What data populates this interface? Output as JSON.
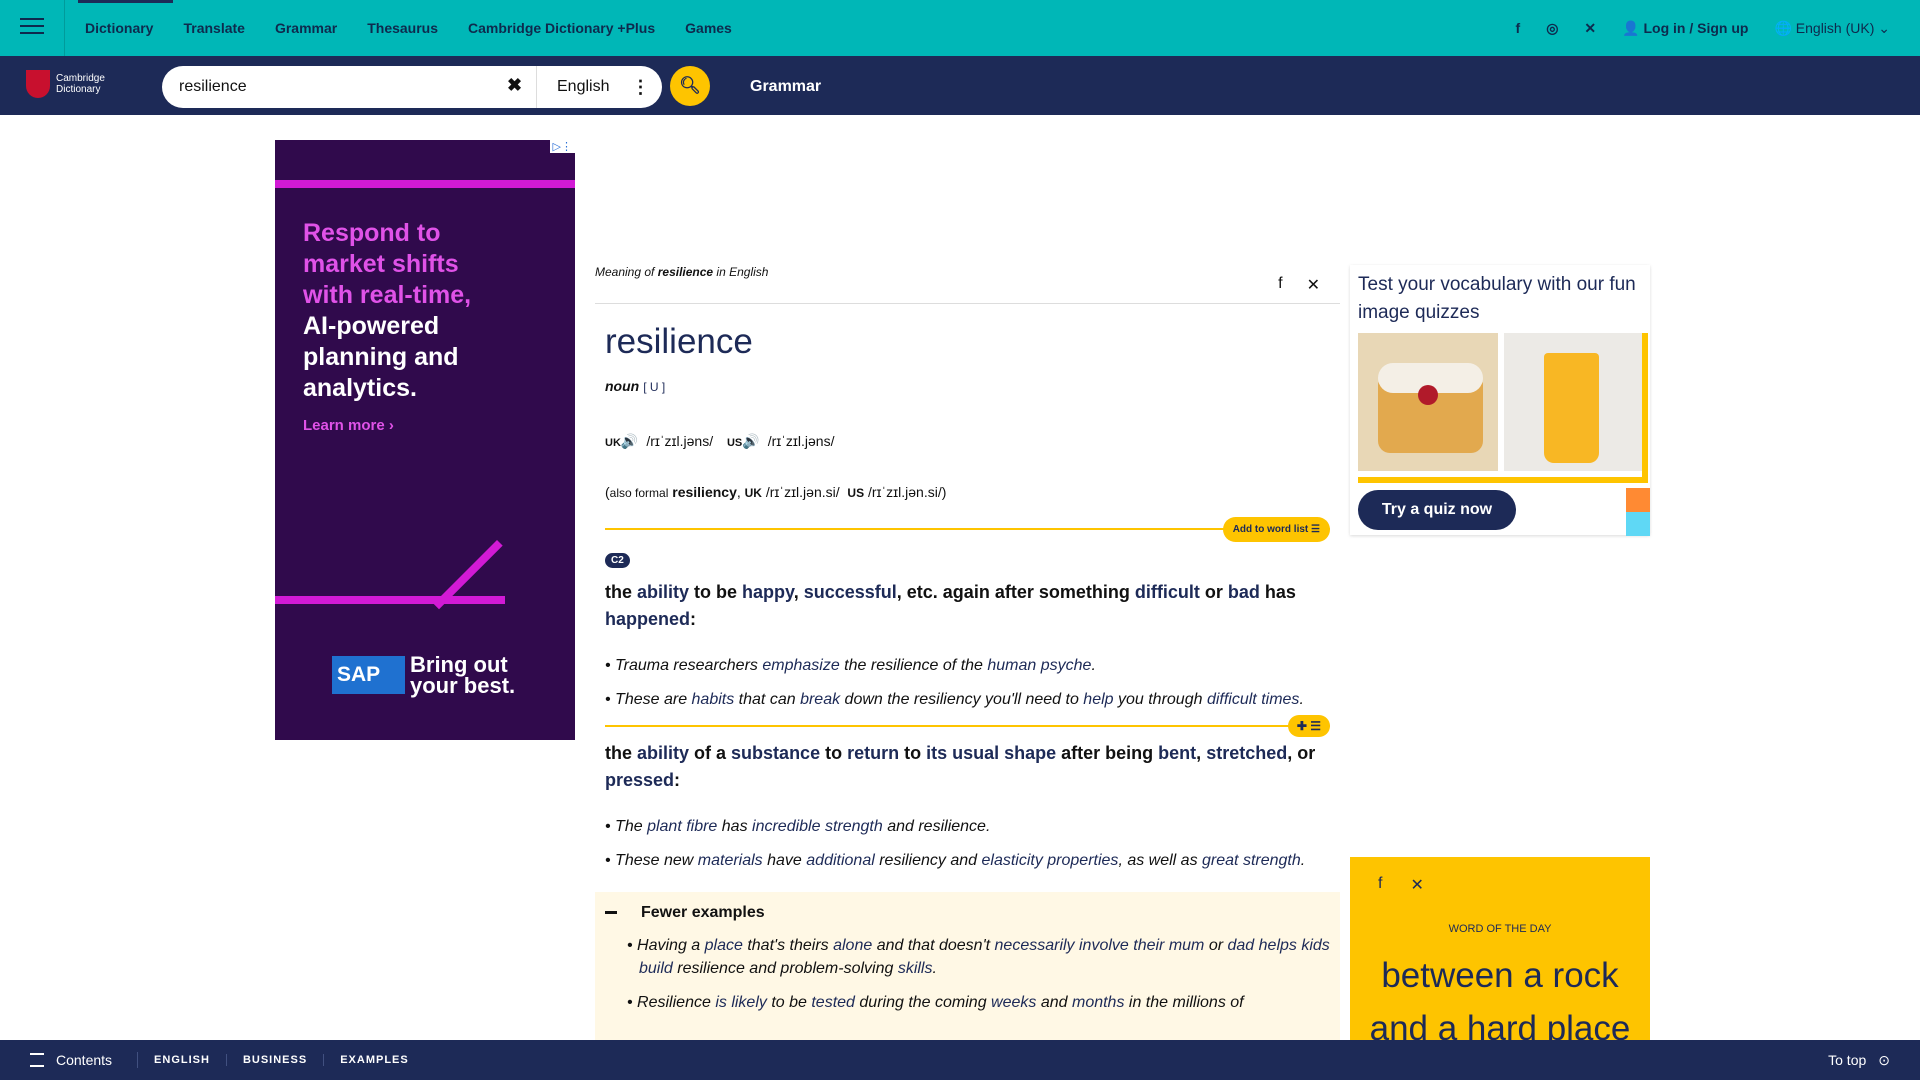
{
  "topnav": {
    "items": [
      "Dictionary",
      "Translate",
      "Grammar",
      "Thesaurus",
      "Cambridge Dictionary +Plus",
      "Games"
    ],
    "login": "Log in / Sign up",
    "language": "English (UK)"
  },
  "searchbar": {
    "logo_line1": "Cambridge",
    "logo_line2": "Dictionary",
    "query": "resilience",
    "dictionary": "English",
    "grammar_link": "Grammar"
  },
  "ad": {
    "line1": "Respond to",
    "line2": "market shifts",
    "line3": "with real-time,",
    "line4": "AI-powered",
    "line5": "planning and",
    "line6": "analytics.",
    "cta": "Learn more",
    "brand": "SAP",
    "tagline1": "Bring out",
    "tagline2": "your best."
  },
  "entry": {
    "meaning_prefix": "Meaning of ",
    "meaning_word": "resilience",
    "meaning_suffix": " in English",
    "headword": "resilience",
    "pos": "noun",
    "grammar": "[ U ]",
    "uk_label": "UK",
    "uk_ipa": "/rɪˈzɪl.jəns/",
    "us_label": "US",
    "us_ipa": "/rɪˈzɪl.jəns/",
    "also_open": "(",
    "also_formal": "also formal",
    "also_word": "resiliency",
    "also_uk_label": "UK",
    "also_uk_ipa": "/rɪˈzɪl.jən.si/",
    "also_us_label": "US",
    "also_us_ipa": "/rɪˈzɪl.jən.si/",
    "also_close": ")",
    "add_to_list": "Add to word list",
    "level": "C2",
    "sense1": {
      "def_parts": [
        "the ",
        "ability",
        " to be ",
        "happy",
        ", ",
        "successful",
        ", etc. again after something ",
        "difficult",
        " or ",
        "bad",
        " has ",
        "happened",
        ":"
      ],
      "ex1_parts": [
        "Trauma researchers ",
        "emphasize",
        " the resilience of the ",
        "human psyche",
        "."
      ],
      "ex2_parts": [
        "These are ",
        "habits",
        " that can ",
        "break",
        " down the resiliency you'll need to ",
        "help",
        " you through ",
        "difficult",
        " ",
        "times",
        "."
      ]
    },
    "sense2": {
      "def_parts": [
        "the ",
        "ability",
        " of a ",
        "substance",
        " to ",
        "return",
        " to ",
        "its usual shape",
        " after being ",
        "bent",
        ", ",
        "stretched",
        ", or ",
        "pressed",
        ":"
      ],
      "ex1_parts": [
        "The ",
        "plant fibre",
        " has ",
        "incredible strength",
        " and resilience."
      ],
      "ex2_parts": [
        "These new ",
        "materials",
        " have ",
        "additional",
        " resiliency and ",
        "elasticity properties",
        ", as well as ",
        "great",
        " ",
        "strength",
        "."
      ]
    },
    "fewer_examples": "Fewer examples",
    "more_ex1_parts": [
      "Having a ",
      "place",
      " that's theirs ",
      "alone",
      " and that doesn't ",
      "necessarily involve their mum",
      " or ",
      "dad",
      " ",
      "helps kids build",
      " resilience and problem-solving ",
      "skills",
      "."
    ],
    "more_ex2_parts": [
      "Resilience ",
      "is likely",
      " to be ",
      "tested",
      " during the coming ",
      "weeks",
      " and ",
      "months",
      " in the millions of"
    ]
  },
  "quiz": {
    "title": "Test your vocabulary with our fun image quizzes",
    "button": "Try a quiz now"
  },
  "wotd": {
    "label": "WORD OF THE DAY",
    "word": "between a rock and a hard place"
  },
  "bottombar": {
    "contents": "Contents",
    "tabs": [
      "ENGLISH",
      "BUSINESS",
      "EXAMPLES"
    ],
    "to_top": "To top"
  },
  "colors": {
    "teal": "#00b7b7",
    "navy": "#1d2a57",
    "yellow": "#fec400",
    "ad_purple": "#300a4c",
    "ad_pink": "#d21ad5"
  }
}
